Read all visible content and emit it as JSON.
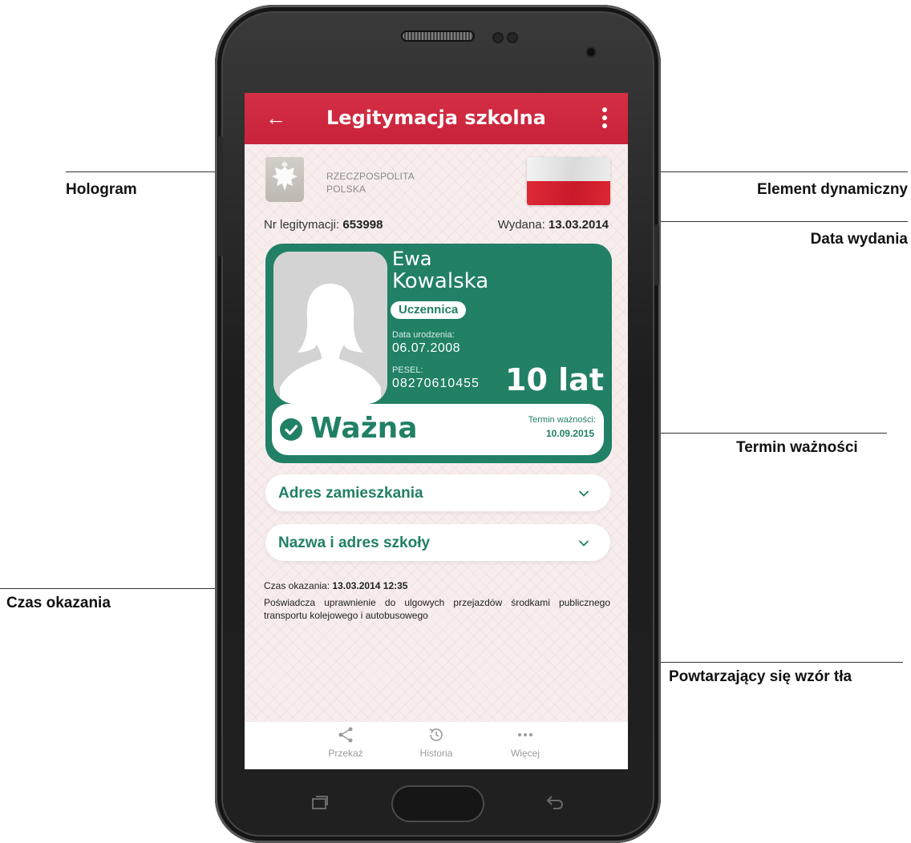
{
  "app": {
    "title": "Legitymacja szkolna"
  },
  "header": {
    "issuer_line1": "RZECZPOSPOLITA",
    "issuer_line2": "POLSKA"
  },
  "document": {
    "number_label": "Nr legitymacji:",
    "number_value": "653998",
    "issued_label": "Wydana:",
    "issued_value": "13.03.2014"
  },
  "card": {
    "first_name": "Ewa",
    "last_name": "Kowalska",
    "role": "Uczennica",
    "dob_label": "Data urodzenia:",
    "dob_value": "06.07.2008",
    "pesel_label": "PESEL:",
    "pesel_value": "08270610455",
    "age": "10 lat",
    "status": "Ważna",
    "valid_until_label": "Termin ważności:",
    "valid_until_value": "10.09.2015",
    "accent_color": "#218066"
  },
  "sections": [
    {
      "label": "Adres zamieszkania"
    },
    {
      "label": "Nazwa i adres szkoły"
    }
  ],
  "footer": {
    "shown_label": "Czas okazania:",
    "shown_value": "13.03.2014 12:35",
    "description": "Poświadcza uprawnienie do ulgowych przejazdów środkami publicznego transportu kolejowego i autobusowego"
  },
  "bottom_nav": [
    {
      "label": "Przekaż",
      "icon": "share-icon"
    },
    {
      "label": "Historia",
      "icon": "history-icon"
    },
    {
      "label": "Więcej",
      "icon": "more-icon"
    }
  ],
  "annotations": {
    "hologram": "Hologram",
    "dynamic": "Element dynamiczny",
    "issue_date": "Data wydania",
    "validity": "Termin ważności",
    "shown_time": "Czas okazania",
    "pattern": "Powtarzający się wzór tła"
  },
  "colors": {
    "topbar": "#c8223a",
    "card": "#218066",
    "background": "#f7eded"
  }
}
